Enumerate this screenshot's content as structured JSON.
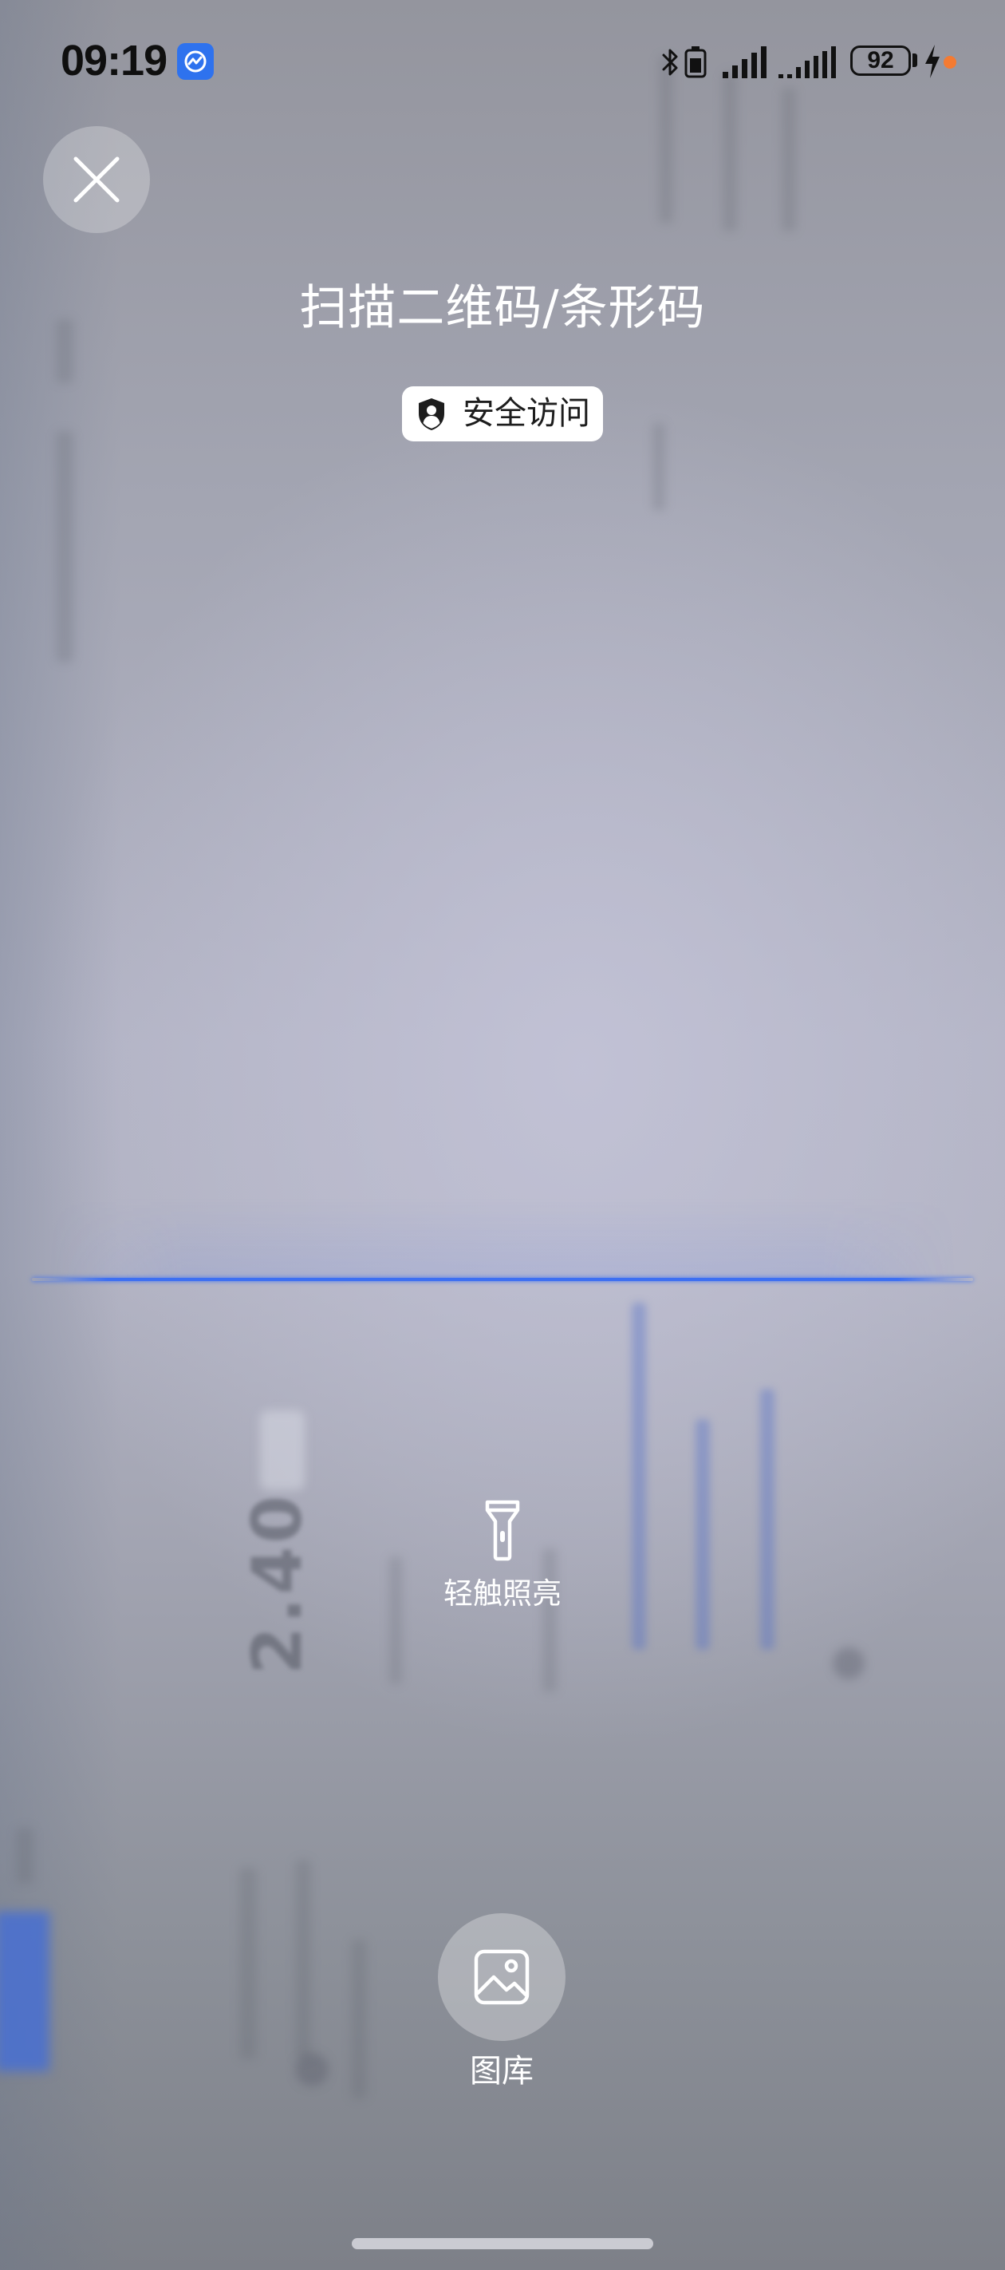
{
  "status_bar": {
    "time": "09:19",
    "app_icon": "scan-app-icon",
    "icons": [
      "bluetooth-icon",
      "device-battery-icon",
      "signal-icon",
      "signal-icon",
      "battery-icon",
      "charging-icon"
    ],
    "battery_level": "92",
    "notification_dot_color": "#f47b32"
  },
  "header": {
    "close_icon": "close-icon",
    "title": "扫描二维码/条形码",
    "badge": {
      "icon": "shield-user-icon",
      "label": "安全访问"
    }
  },
  "scanner": {
    "scan_line_color": "#3d6ff2"
  },
  "flashlight": {
    "icon": "flashlight-icon",
    "label": "轻触照亮"
  },
  "gallery": {
    "icon": "image-icon",
    "label": "图库"
  },
  "camera_feed": {
    "blurred_text": "2.40"
  },
  "colors": {
    "overlay_text": "#ffffff",
    "badge_background": "#ffffff",
    "status_text": "#0f0f0f",
    "app_icon_background": "#2e72ee"
  }
}
